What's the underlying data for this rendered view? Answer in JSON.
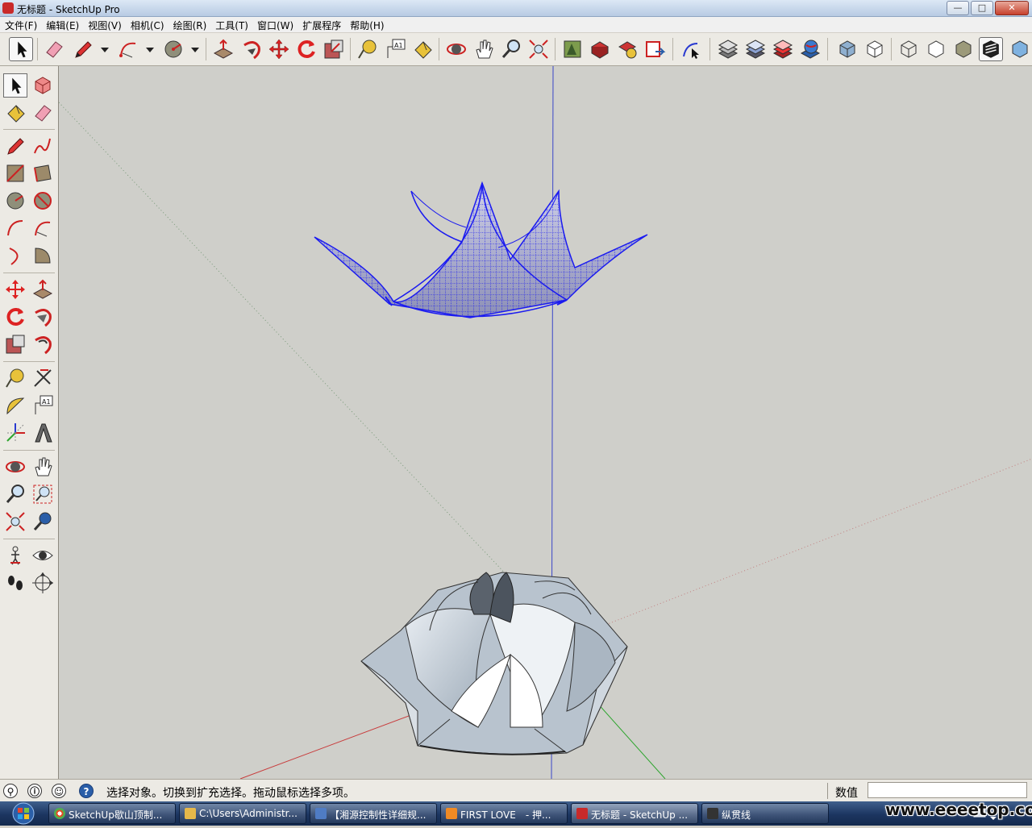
{
  "window": {
    "title": "无标题 - SketchUp Pro",
    "controls": {
      "minimize": "—",
      "maximize": "□",
      "close": "✕"
    }
  },
  "menu": [
    "文件(F)",
    "编辑(E)",
    "视图(V)",
    "相机(C)",
    "绘图(R)",
    "工具(T)",
    "窗口(W)",
    "扩展程序",
    "帮助(H)"
  ],
  "status": {
    "message": "选择对象。切换到扩充选择。拖动鼠标选择多项。",
    "vcb_label": "数值",
    "vcb_value": ""
  },
  "taskbar": {
    "tasks": [
      {
        "label": "SketchUp歇山顶制...",
        "color": "#e44d26"
      },
      {
        "label": "C:\\Users\\Administr...",
        "color": "#e6b84a"
      },
      {
        "label": "【湘源控制性详细规...",
        "color": "#4f7cc4"
      },
      {
        "label": "FIRST LOVE　- 押...",
        "color": "#f08a24"
      },
      {
        "label": "无标题 - SketchUp ...",
        "color": "#c92a2a"
      },
      {
        "label": "纵贯线",
        "color": "#333333"
      }
    ],
    "active_task": "4"
  },
  "watermark": "www.eeeetop.com",
  "colors": {
    "selected_mesh": "#1a1af0",
    "canvas": "#cfcfca",
    "axis_red": "#c83c3c",
    "axis_green": "#2ea52e",
    "axis_blue": "#2a3ad0"
  }
}
